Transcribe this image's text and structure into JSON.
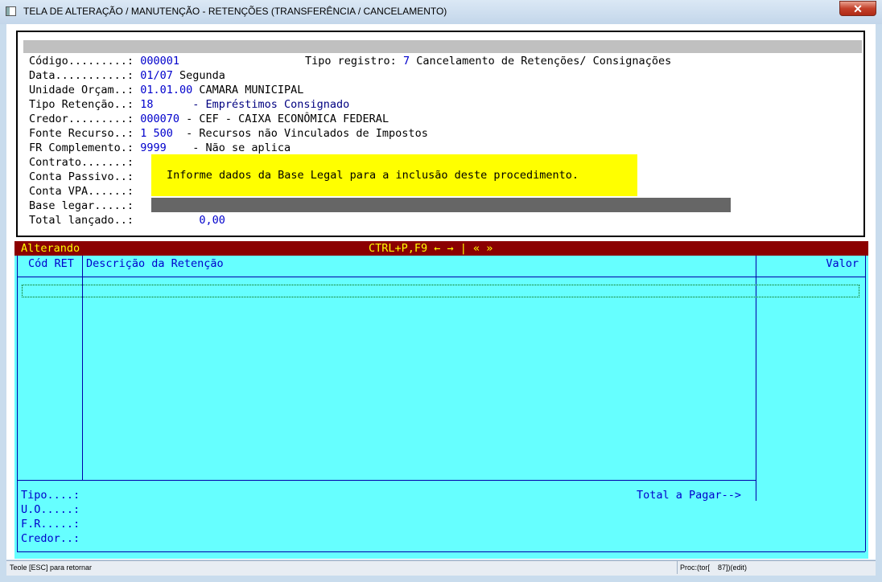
{
  "window": {
    "title": "TELA DE ALTERAÇÃO / MANUTENÇÃO - RETENÇÕES (TRANSFERÊNCIA / CANCELAMENTO)",
    "close_label": "✕"
  },
  "form": {
    "codigo_label": "Código.........:",
    "codigo_value": "000001",
    "tipo_registro_label": "Tipo registro:",
    "tipo_registro_code": "7",
    "tipo_registro_desc": "Cancelamento de Retenções/ Consignações",
    "data_label": "Data...........:",
    "data_value": "01/07",
    "data_weekday": "Segunda",
    "unidade_label": "Unidade Orçam..:",
    "unidade_code": "01.01.00",
    "unidade_desc": "CAMARA MUNICIPAL",
    "tipo_retencao_label": "Tipo Retenção..:",
    "tipo_retencao_code": "18",
    "tipo_retencao_desc": "- Empréstimos Consignado",
    "credor_label": "Credor.........:",
    "credor_code": "000070",
    "credor_desc": "- CEF - CAIXA ECONÔMICA FEDERAL",
    "fonte_label": "Fonte Recurso..:",
    "fonte_code": "1 500",
    "fonte_desc": "- Recursos não Vinculados de Impostos",
    "fr_label": "FR Complemento.:",
    "fr_code": "9999",
    "fr_desc": "- Não se aplica",
    "contrato_label": "Contrato.......:",
    "conta_passivo_label": "Conta Passivo..:",
    "conta_vpa_label": "Conta VPA......:",
    "base_legar_label": "Base legar.....:",
    "total_label": "Total lançado..:",
    "total_value": "0,00",
    "message": "Informe dados da Base Legal para a inclusão deste procedimento."
  },
  "status_bar": {
    "mode": "Alterando",
    "shortcuts": "CTRL+P,F9 ← → | « »"
  },
  "grid": {
    "col_cod": "Cód RET",
    "col_desc": "Descrição da Retenção",
    "col_valor": "Valor",
    "tipo_label": "Tipo....:",
    "uo_label": "U.O.....:",
    "fr_label": "F.R.....:",
    "credor_label": "Credor..:",
    "total_pagar_label": "Total a Pagar-->"
  },
  "bottom": {
    "hint": "Teole [ESC] para retornar",
    "proc": "Proc:(tor[    87])(edit)"
  }
}
